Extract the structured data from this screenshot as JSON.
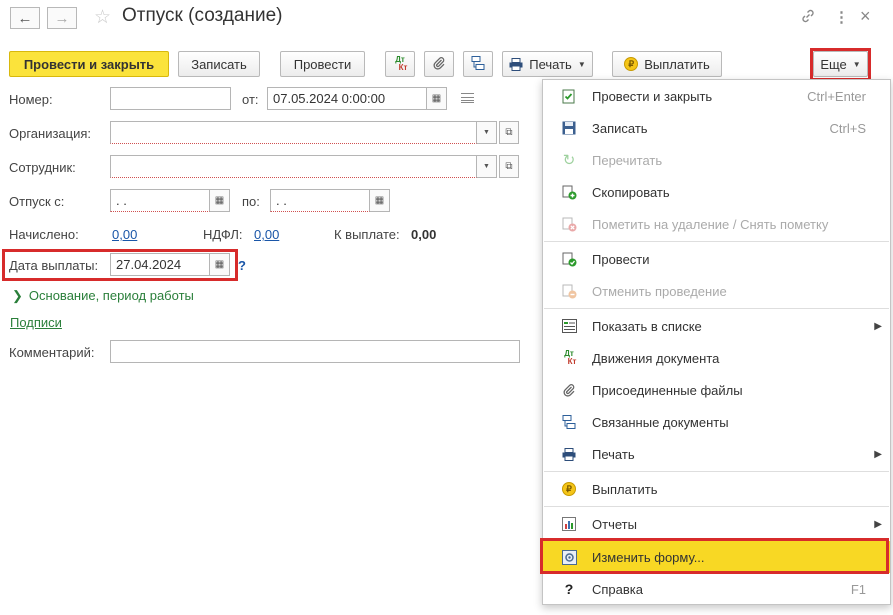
{
  "window": {
    "title": "Отпуск (создание)",
    "back_icon": "arrow-left-icon",
    "forward_icon": "arrow-right-icon",
    "favorite_icon": "star-icon",
    "link_icon": "link-icon",
    "more_icon": "vertical-dots-icon",
    "close_icon": "close-icon"
  },
  "toolbar": {
    "post_and_close": "Провести и закрыть",
    "save": "Записать",
    "post": "Провести",
    "dt_label": "Дт",
    "kt_label": "Кт",
    "print": "Печать",
    "pay": "Выплатить",
    "more": "Еще",
    "coin_glyph": "₽"
  },
  "form": {
    "number_label": "Номер:",
    "number_value": "",
    "from_label": "от:",
    "from_value": "07.05.2024  0:00:00",
    "organization_label": "Организация:",
    "organization_value": "",
    "employee_label": "Сотрудник:",
    "employee_value": "",
    "vacation_from_label": "Отпуск с:",
    "vacation_from_value": " .  .",
    "to_label": "по:",
    "to_value": " .  .",
    "accrued_label": "Начислено:",
    "accrued_value": "0,00",
    "ndfl_label": "НДФЛ:",
    "ndfl_value": "0,00",
    "to_pay_label": "К выплате:",
    "to_pay_value": "0,00",
    "payment_date_label": "Дата выплаты:",
    "payment_date_value": "27.04.2024",
    "help_mark": "?",
    "basis_section": "Основание, период работы",
    "signatures_link": "Подписи",
    "comment_label": "Комментарий:",
    "comment_value": ""
  },
  "menu": {
    "items": [
      {
        "label": "Провести и закрыть",
        "shortcut": "Ctrl+Enter",
        "icon": "post-and-close-icon",
        "disabled": false
      },
      {
        "label": "Записать",
        "shortcut": "Ctrl+S",
        "icon": "save-disk-icon",
        "disabled": false
      },
      {
        "label": "Перечитать",
        "shortcut": "",
        "icon": "reload-icon",
        "disabled": true
      },
      {
        "label": "Скопировать",
        "shortcut": "",
        "icon": "copy-icon",
        "disabled": false
      },
      {
        "label": "Пометить на удаление / Снять пометку",
        "shortcut": "",
        "icon": "delete-mark-icon",
        "disabled": true
      },
      {
        "label": "Провести",
        "shortcut": "",
        "icon": "post-document-icon",
        "disabled": false
      },
      {
        "label": "Отменить проведение",
        "shortcut": "",
        "icon": "cancel-posting-icon",
        "disabled": true
      },
      {
        "label": "Показать в списке",
        "shortcut": "",
        "icon": "show-in-list-icon",
        "disabled": false,
        "submenu": true
      },
      {
        "label": "Движения документа",
        "shortcut": "",
        "icon": "dt-kt-icon",
        "disabled": false
      },
      {
        "label": "Присоединенные файлы",
        "shortcut": "",
        "icon": "paperclip-icon",
        "disabled": false
      },
      {
        "label": "Связанные документы",
        "shortcut": "",
        "icon": "related-documents-icon",
        "disabled": false
      },
      {
        "label": "Печать",
        "shortcut": "",
        "icon": "printer-icon",
        "disabled": false,
        "submenu": true
      },
      {
        "label": "Выплатить",
        "shortcut": "",
        "icon": "coin-icon",
        "disabled": false
      },
      {
        "label": "Отчеты",
        "shortcut": "",
        "icon": "reports-chart-icon",
        "disabled": false,
        "submenu": true
      },
      {
        "label": "Изменить форму...",
        "shortcut": "",
        "icon": "change-form-icon",
        "disabled": false,
        "highlighted": true
      },
      {
        "label": "Справка",
        "shortcut": "F1",
        "icon": "help-icon",
        "disabled": false
      }
    ]
  },
  "colors": {
    "primary_button": "#fbe33b",
    "highlight": "#f8d824",
    "annotation_red": "#d72b2b",
    "link_blue": "#1a56a8",
    "section_green": "#2a7f3a"
  }
}
